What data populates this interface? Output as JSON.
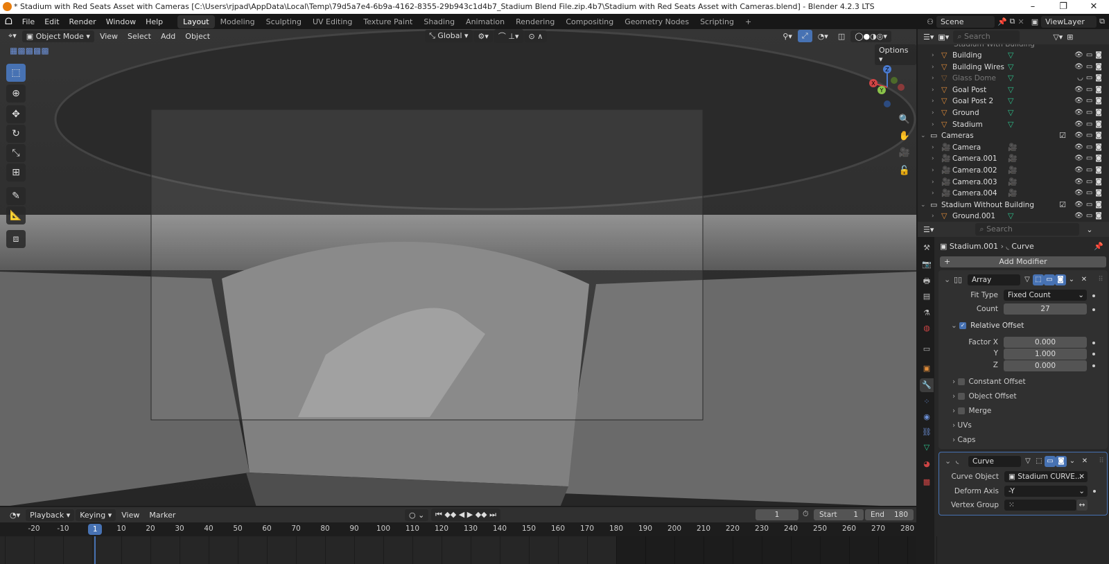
{
  "titlebar": {
    "title": "* Stadium with Red Seats Asset with Cameras [C:\\Users\\rjpad\\AppData\\Local\\Temp\\79d5a7e4-6b9a-4162-8355-29b943c1d4b7_Stadium Blend File.zip.4b7\\Stadium with Red Seats Asset with Cameras.blend] - Blender 4.2.3 LTS",
    "minimize": "–",
    "maximize": "❐",
    "close": "✕"
  },
  "menu": [
    "File",
    "Edit",
    "Render",
    "Window",
    "Help"
  ],
  "workspaces": [
    "Layout",
    "Modeling",
    "Sculpting",
    "UV Editing",
    "Texture Paint",
    "Shading",
    "Animation",
    "Rendering",
    "Compositing",
    "Geometry Nodes",
    "Scripting",
    "+"
  ],
  "scene": {
    "scene": "Scene",
    "view_layer": "ViewLayer"
  },
  "viewport": {
    "mode": "Object Mode",
    "menus": [
      "View",
      "Select",
      "Add",
      "Object"
    ],
    "orientation": "Global",
    "options": "Options",
    "gizmo": {
      "x": "X",
      "y": "Y",
      "z": "Z"
    }
  },
  "outliner": {
    "search_placeholder": "Search",
    "partial_top": "Stadium With Building",
    "rows": [
      {
        "label": "Building",
        "type": "mesh"
      },
      {
        "label": "Building Wires",
        "type": "mesh"
      },
      {
        "label": "Glass Dome",
        "type": "mesh",
        "hidden": true
      },
      {
        "label": "Goal Post",
        "type": "mesh"
      },
      {
        "label": "Goal Post 2",
        "type": "mesh"
      },
      {
        "label": "Ground",
        "type": "mesh"
      },
      {
        "label": "Stadium",
        "type": "mesh"
      },
      {
        "label": "Cameras",
        "type": "collection"
      },
      {
        "label": "Camera",
        "type": "camera"
      },
      {
        "label": "Camera.001",
        "type": "camera"
      },
      {
        "label": "Camera.002",
        "type": "camera"
      },
      {
        "label": "Camera.003",
        "type": "camera"
      },
      {
        "label": "Camera.004",
        "type": "camera"
      },
      {
        "label": "Stadium Without Building",
        "type": "collection"
      },
      {
        "label": "Ground.001",
        "type": "mesh"
      }
    ]
  },
  "properties": {
    "search_placeholder": "Search",
    "breadcrumb": {
      "object": "Stadium.001",
      "modifier": "Curve"
    },
    "add_modifier": "Add Modifier",
    "array": {
      "name": "Array",
      "fit_type_label": "Fit Type",
      "fit_type": "Fixed Count",
      "count_label": "Count",
      "count": "27",
      "relative_offset": "Relative Offset",
      "factor_x_label": "Factor X",
      "factor_x": "0.000",
      "y_label": "Y",
      "y": "1.000",
      "z_label": "Z",
      "z": "0.000",
      "constant_offset": "Constant Offset",
      "object_offset": "Object Offset",
      "merge": "Merge",
      "uvs": "UVs",
      "caps": "Caps"
    },
    "curve": {
      "name": "Curve",
      "curve_object_label": "Curve Object",
      "curve_object": "Stadium CURVE...",
      "deform_axis_label": "Deform Axis",
      "deform_axis": "-Y",
      "vertex_group_label": "Vertex Group"
    }
  },
  "timeline": {
    "menus": [
      "Playback",
      "Keying",
      "View",
      "Marker"
    ],
    "current_frame": "1",
    "start_label": "Start",
    "start": "1",
    "end_label": "End",
    "end": "180",
    "ticks": [
      -20,
      -10,
      10,
      20,
      30,
      40,
      50,
      60,
      70,
      80,
      90,
      100,
      110,
      120,
      130,
      140,
      150,
      160,
      170,
      180,
      190,
      200,
      210,
      220,
      230,
      240,
      250,
      260,
      270,
      280
    ],
    "playhead": 1
  }
}
